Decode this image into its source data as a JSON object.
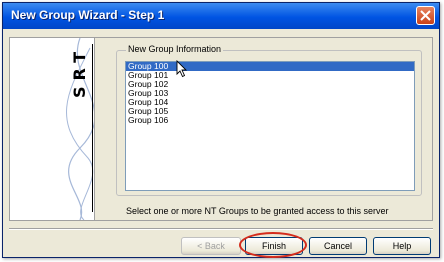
{
  "window": {
    "title": "New Group Wizard - Step 1"
  },
  "logo": {
    "text": "SRT"
  },
  "group": {
    "label": "New Group Information",
    "items": [
      "Group 100",
      "Group 101",
      "Group 102",
      "Group 103",
      "Group 104",
      "Group 105",
      "Group 106"
    ],
    "selected_index": 0
  },
  "hint": "Select one or more NT Groups to be granted access to this server",
  "buttons": {
    "back": "< Back",
    "finish": "Finish",
    "cancel": "Cancel",
    "help": "Help"
  },
  "colors": {
    "titlebar": "#0054e3",
    "selection": "#316ac5",
    "highlight_ring": "#d42c1c"
  },
  "icons": {
    "close": "close-icon",
    "cursor": "mouse-pointer-icon"
  }
}
